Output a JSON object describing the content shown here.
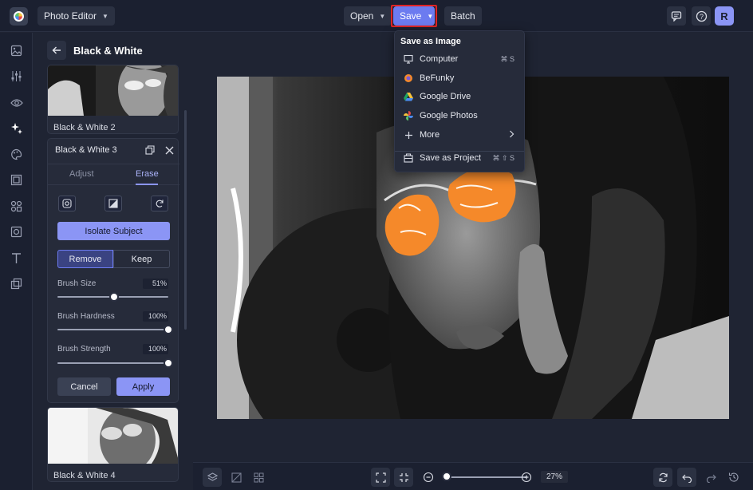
{
  "topbar": {
    "app_menu_label": "Photo Editor",
    "open_label": "Open",
    "save_label": "Save",
    "batch_label": "Batch",
    "avatar_initial": "R",
    "icons": [
      "befunky-logo-icon",
      "chevron-down-icon",
      "message-icon",
      "help-icon"
    ]
  },
  "rail": {
    "icons": [
      "image-icon",
      "adjust-sliders-icon",
      "eye-icon",
      "effects-sparkle-icon",
      "paint-palette-icon",
      "frame-icon",
      "graphics-icon",
      "overlay-texture-icon",
      "text-icon",
      "layers-image-icon"
    ],
    "active_index": 3
  },
  "panel": {
    "title": "Black & White",
    "thumb_above_label": "Black & White 2",
    "thumb_below_label": "Black & White 4",
    "effect": {
      "title": "Black & White 3",
      "tabs": [
        "Adjust",
        "Erase"
      ],
      "active_tab": "Erase",
      "isolate_label": "Isolate Subject",
      "mode_remove": "Remove",
      "mode_keep": "Keep",
      "active_mode": "Remove",
      "sliders": [
        {
          "label": "Brush Size",
          "value_text": "51%",
          "level": 0.51
        },
        {
          "label": "Brush Hardness",
          "value_text": "100%",
          "level": 1.0
        },
        {
          "label": "Brush Strength",
          "value_text": "100%",
          "level": 1.0
        }
      ],
      "cancel_label": "Cancel",
      "apply_label": "Apply"
    }
  },
  "save_menu": {
    "heading": "Save as Image",
    "items": [
      {
        "label": "Computer",
        "icon": "monitor-icon",
        "shortcut": "⌘ S"
      },
      {
        "label": "BeFunky",
        "icon": "befunky-icon",
        "shortcut": ""
      },
      {
        "label": "Google Drive",
        "icon": "google-drive-icon",
        "shortcut": ""
      },
      {
        "label": "Google Photos",
        "icon": "google-photos-icon",
        "shortcut": ""
      },
      {
        "label": "More",
        "icon": "plus-icon",
        "shortcut": ""
      }
    ],
    "project_item": {
      "label": "Save as Project",
      "icon": "project-icon",
      "shortcut": "⌘ ⇧ S"
    }
  },
  "bottombar": {
    "zoom_text": "27%",
    "zoom_level": 0.0
  },
  "colors": {
    "accent": "#8b95f5",
    "save_button": "#6c7bf0",
    "highlight_outline": "#e02424",
    "background": "#1f2433"
  }
}
